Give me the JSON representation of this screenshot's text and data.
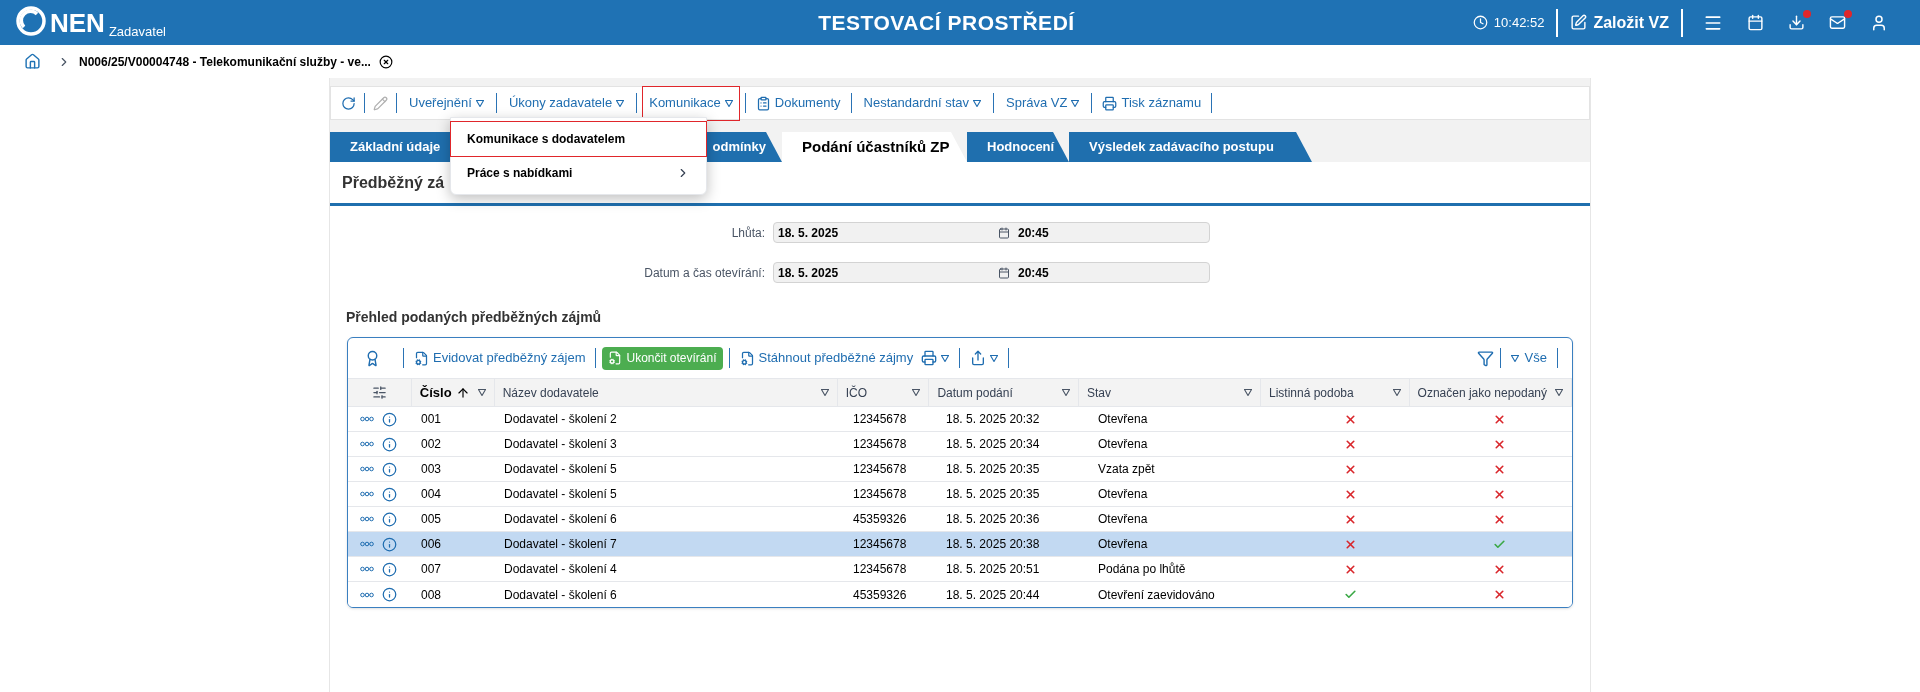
{
  "header": {
    "logo": "NEN",
    "role": "Zadavatel",
    "title": "TESTOVACÍ PROSTŘEDÍ",
    "time": "10:42:52",
    "create_button": "Založit VZ",
    "download_badge": true,
    "mail_badge": true
  },
  "breadcrumb": {
    "label": "N006/25/V00004748 - Telekomunikační služby - ve..."
  },
  "toolbar": [
    {
      "kind": "refresh",
      "disabled": false,
      "outlined": false
    },
    {
      "kind": "edit",
      "disabled": true,
      "outlined": false
    },
    {
      "kind": "menu",
      "label": "Uveřejnění",
      "disabled": false,
      "outlined": false
    },
    {
      "kind": "menu",
      "label": "Úkony zadavatele",
      "disabled": false,
      "outlined": false
    },
    {
      "kind": "menu",
      "label": "Komunikace",
      "disabled": false,
      "outlined": true
    },
    {
      "kind": "document",
      "label": "Dokumenty",
      "disabled": false,
      "outlined": false
    },
    {
      "kind": "menu",
      "label": "Nestandardní stav",
      "disabled": false,
      "outlined": false
    },
    {
      "kind": "menu",
      "label": "Správa VZ",
      "disabled": false,
      "outlined": false
    },
    {
      "kind": "print",
      "label": "Tisk záznamu",
      "disabled": false,
      "outlined": false
    }
  ],
  "dropdown": [
    {
      "label": "Komunikace s dodavatelem",
      "outlined": true,
      "submenu": false
    },
    {
      "label": "Práce s nabídkami",
      "outlined": false,
      "submenu": true
    }
  ],
  "tabs": [
    {
      "label": "Základní údaje",
      "selected": false
    },
    {
      "label": "odmínky",
      "selected": false
    },
    {
      "label": "Podání účastníků ZP",
      "selected": true
    },
    {
      "label": "Hodnocení",
      "selected": false
    },
    {
      "label": "Výsledek zadávacího postupu",
      "selected": false
    }
  ],
  "panel_title": "Předběžný zá",
  "fields": [
    {
      "label": "Lhůta:",
      "date": "18. 5. 2025",
      "time": "20:45"
    },
    {
      "label": "Datum a čas otevírání:",
      "date": "18. 5. 2025",
      "time": "20:45"
    }
  ],
  "section_title": "Přehled podaných předběžných zájmů",
  "grid": {
    "toolbar": [
      {
        "kind": "award"
      },
      {
        "kind": "link",
        "label": "Evidovat předběžný zájem"
      },
      {
        "kind": "primary",
        "label": "Ukončit otevírání"
      },
      {
        "kind": "link",
        "label": "Stáhnout předběžné zájmy"
      },
      {
        "kind": "print"
      },
      {
        "kind": "export"
      }
    ],
    "filter_label": "Vše",
    "columns": [
      {
        "label": "Číslo",
        "sorted": true
      },
      {
        "label": "Název dodavatele",
        "sorted": false
      },
      {
        "label": "IČO",
        "sorted": false
      },
      {
        "label": "Datum podání",
        "sorted": false
      },
      {
        "label": "Stav",
        "sorted": false
      },
      {
        "label": "Listinná podoba",
        "sorted": false
      },
      {
        "label": "Označen jako nepodaný",
        "sorted": false
      }
    ],
    "rows": [
      {
        "number": "001",
        "supplier": "Dodavatel - školení 2",
        "ico": "12345678",
        "date": "18. 5. 2025 20:32",
        "status": "Otevřena",
        "paper": false,
        "unsubmitted": false,
        "selected": false
      },
      {
        "number": "002",
        "supplier": "Dodavatel - školení 3",
        "ico": "12345678",
        "date": "18. 5. 2025 20:34",
        "status": "Otevřena",
        "paper": false,
        "unsubmitted": false,
        "selected": false
      },
      {
        "number": "003",
        "supplier": "Dodavatel - školení 5",
        "ico": "12345678",
        "date": "18. 5. 2025 20:35",
        "status": "Vzata zpět",
        "paper": false,
        "unsubmitted": false,
        "selected": false
      },
      {
        "number": "004",
        "supplier": "Dodavatel - školení 5",
        "ico": "12345678",
        "date": "18. 5. 2025 20:35",
        "status": "Otevřena",
        "paper": false,
        "unsubmitted": false,
        "selected": false
      },
      {
        "number": "005",
        "supplier": "Dodavatel - školení 6",
        "ico": "45359326",
        "date": "18. 5. 2025 20:36",
        "status": "Otevřena",
        "paper": false,
        "unsubmitted": false,
        "selected": false
      },
      {
        "number": "006",
        "supplier": "Dodavatel - školení 7",
        "ico": "12345678",
        "date": "18. 5. 2025 20:38",
        "status": "Otevřena",
        "paper": false,
        "unsubmitted": true,
        "selected": true
      },
      {
        "number": "007",
        "supplier": "Dodavatel - školení 4",
        "ico": "12345678",
        "date": "18. 5. 2025 20:51",
        "status": "Podána po lhůtě",
        "paper": false,
        "unsubmitted": false,
        "selected": false
      },
      {
        "number": "008",
        "supplier": "Dodavatel - školení 6",
        "ico": "45359326",
        "date": "18. 5. 2025 20:44",
        "status": "Otevření zaevidováno",
        "paper": true,
        "unsubmitted": false,
        "selected": false
      }
    ]
  }
}
